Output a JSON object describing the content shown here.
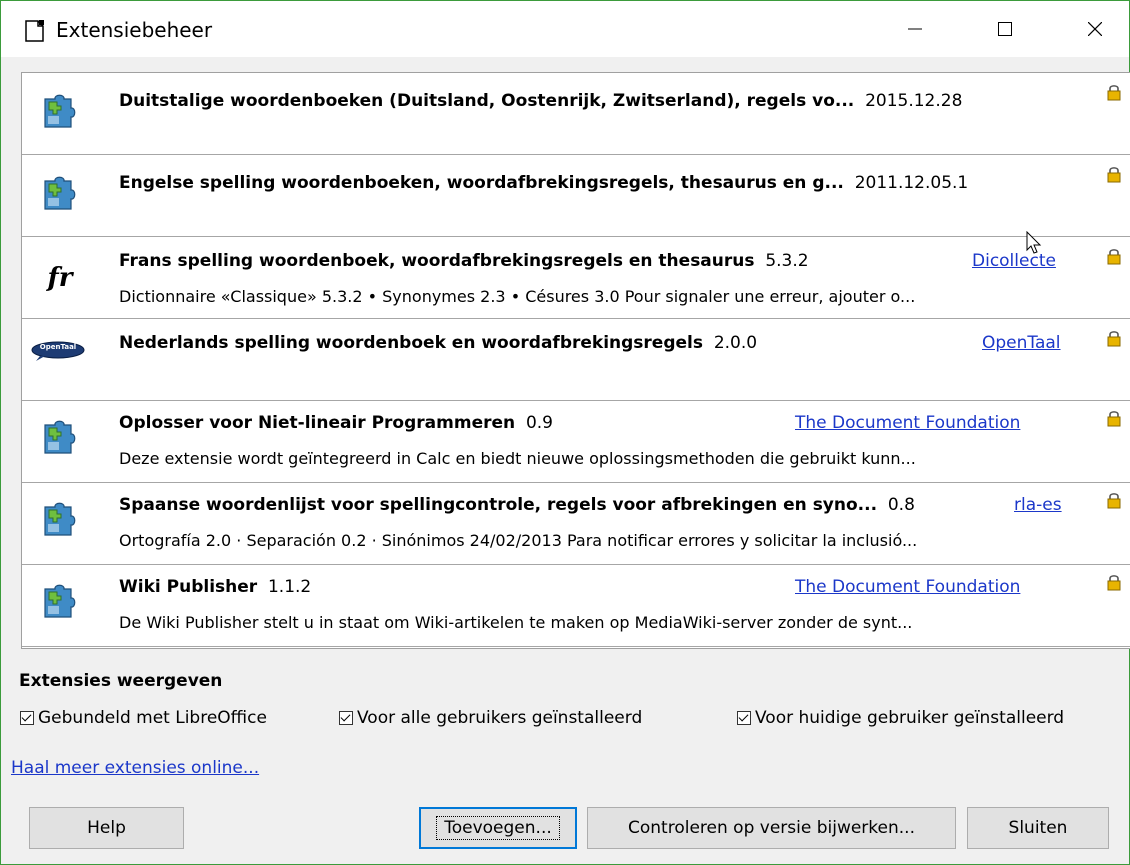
{
  "window": {
    "title": "Extensiebeheer"
  },
  "extensions": [
    {
      "title": "Duitstalige woordenboeken (Duitsland, Oostenrijk, Zwitserland), regels vo...",
      "version": "2015.12.28",
      "publisher": "",
      "description": "",
      "icon": "puzzle-icon"
    },
    {
      "title": "Engelse spelling woordenboeken, woordafbrekingsregels, thesaurus en g...",
      "version": "2011.12.05.1",
      "publisher": "",
      "description": "",
      "icon": "puzzle-icon"
    },
    {
      "title": "Frans spelling woordenboek, woordafbrekingsregels en thesaurus",
      "version": "5.3.2",
      "publisher": "Dicollecte",
      "description": "Dictionnaire «Classique» 5.3.2 • Synonymes 2.3 • Césures 3.0  Pour signaler une erreur, ajouter o...",
      "icon": "fr-icon",
      "icon_text": "fr"
    },
    {
      "title": "Nederlands spelling woordenboek en woordafbrekingsregels",
      "version": "2.0.0",
      "publisher": "OpenTaal",
      "description": "",
      "icon": "opentaal-logo-icon",
      "icon_text": "OpenTaal"
    },
    {
      "title": "Oplosser voor Niet-lineair Programmeren",
      "version": "0.9",
      "publisher": "The Document Foundation",
      "description": "Deze extensie wordt geïntegreerd in Calc en biedt nieuwe oplossingsmethoden die gebruikt kunn...",
      "icon": "puzzle-icon"
    },
    {
      "title": "Spaanse woordenlijst voor spellingcontrole, regels voor afbrekingen en syno...",
      "version": "0.8",
      "publisher": "rla-es",
      "description": "Ortografía 2.0 · Separación 0.2 · Sinónimos 24/02/2013  Para notificar errores y solicitar la inclusió...",
      "icon": "puzzle-icon"
    },
    {
      "title": "Wiki Publisher",
      "version": "1.1.2",
      "publisher": "The Document Foundation",
      "description": "De Wiki Publisher stelt u in staat om Wiki-artikelen te maken op MediaWiki-server zonder de synt...",
      "icon": "puzzle-icon"
    }
  ],
  "filter": {
    "heading": "Extensies weergeven",
    "bundled": {
      "label": "Gebundeld met LibreOffice",
      "checked": true
    },
    "all_users": {
      "label": "Voor alle gebruikers geïnstalleerd",
      "checked": true
    },
    "current_user": {
      "label": "Voor huidige gebruiker geïnstalleerd",
      "checked": true
    }
  },
  "online_link": "Haal meer extensies online...",
  "buttons": {
    "help": "Help",
    "add": "Toevoegen...",
    "check_updates": "Controleren op versie bijwerken...",
    "close": "Sluiten"
  },
  "colors": {
    "link": "#1b37c9",
    "window_border": "#3b9b3b",
    "focus": "#0078d7",
    "puzzle_green": "#3c9a3c",
    "puzzle_blue": "#3f8bc6"
  }
}
